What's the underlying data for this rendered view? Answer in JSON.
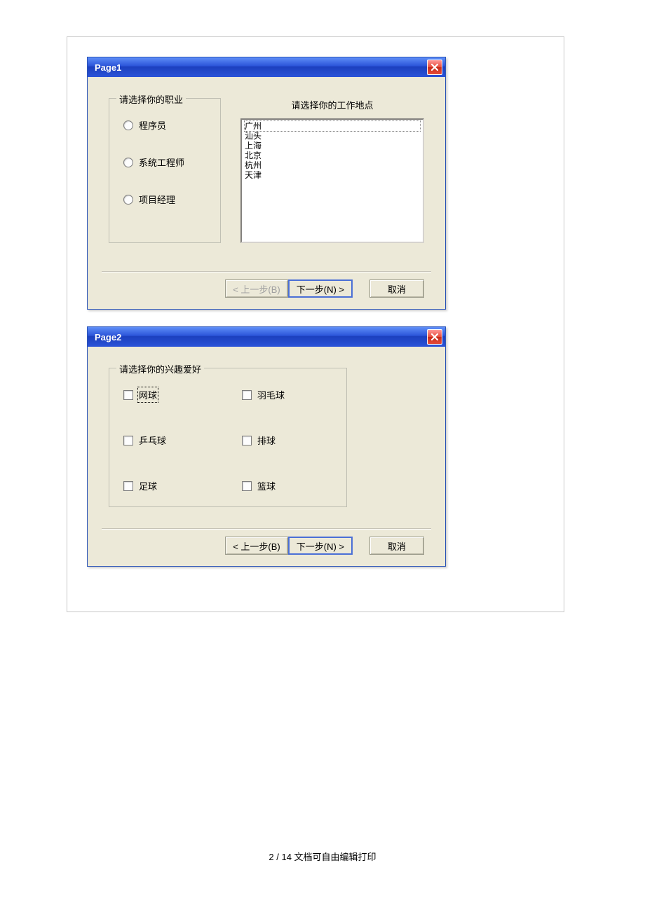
{
  "footer": {
    "text": "2 / 14 文档可自由编辑打印"
  },
  "dialog1": {
    "title": "Page1",
    "group_occ": {
      "legend": "请选择你的职业",
      "options": [
        "程序员",
        "系统工程师",
        "项目经理"
      ]
    },
    "loc_label": "请选择你的工作地点",
    "locations": [
      "广州",
      "汕头",
      "上海",
      "北京",
      "杭州",
      "天津"
    ],
    "buttons": {
      "back": "< 上一步(B)",
      "next": "下一步(N) >",
      "cancel": "取消"
    }
  },
  "dialog2": {
    "title": "Page2",
    "group_hobby": {
      "legend": "请选择你的兴趣爱好",
      "options": [
        "网球",
        "羽毛球",
        "乒乓球",
        "排球",
        "足球",
        "篮球"
      ]
    },
    "buttons": {
      "back": "< 上一步(B)",
      "next": "下一步(N) >",
      "cancel": "取消"
    }
  }
}
